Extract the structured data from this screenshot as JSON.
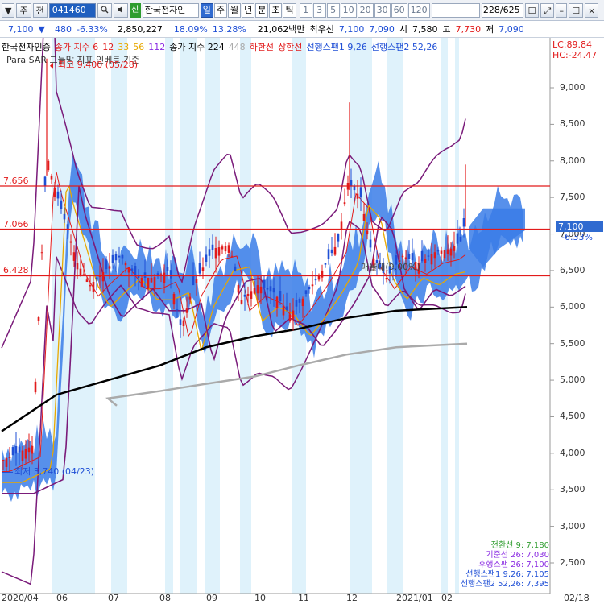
{
  "toolbar": {
    "btn_menu": "▼",
    "btn_ju": "주",
    "btn_jeon": "전",
    "code": "041460",
    "search_icon": "magnifier",
    "sound_icon": "speaker",
    "badge": "신",
    "stock_name": "한국전자인",
    "periods": [
      {
        "label": "일",
        "active": true
      },
      {
        "label": "주",
        "active": false
      },
      {
        "label": "월",
        "active": false
      },
      {
        "label": "년",
        "active": false
      },
      {
        "label": "분",
        "active": false
      },
      {
        "label": "초",
        "active": false
      },
      {
        "label": "틱",
        "active": false
      }
    ],
    "num_periods": [
      "1",
      "3",
      "5",
      "10",
      "20",
      "30",
      "60",
      "120"
    ],
    "pager": "228/625",
    "right_icons": [
      "checkbox-icon",
      "fullscreen-icon",
      "minimize-icon",
      "maximize-icon",
      "close-icon"
    ]
  },
  "info": {
    "price": "7,100",
    "arrow": "▼",
    "change": "480",
    "change_pct": "-6.33%",
    "volume": "2,850,227",
    "rate1": "18.09%",
    "rate2": "13.28%",
    "amount": "21,062백만",
    "label_uc": "최우선",
    "bid": "7,100",
    "ask": "7,090",
    "open_label": "시",
    "open": "7,580",
    "high_label": "고",
    "high": "7,730",
    "low_label": "저",
    "low": "7,090"
  },
  "legend": {
    "line1_items": [
      {
        "text": "한국전자인증",
        "color": "#000000"
      },
      {
        "text": "종가 지수 6",
        "color": "#e21b1b"
      },
      {
        "text": "12",
        "color": "#e21b1b"
      },
      {
        "text": "33",
        "color": "#e8a800"
      },
      {
        "text": "56",
        "color": "#e8a800"
      },
      {
        "text": "112",
        "color": "#8a2be2"
      },
      {
        "text": "종가 지수 224",
        "color": "#000000"
      },
      {
        "text": "448",
        "color": "#aaaaaa"
      },
      {
        "text": "하한선",
        "color": "#e21b1b"
      },
      {
        "text": "상한선",
        "color": "#e21b1b"
      },
      {
        "text": "선행스팬1 9,26",
        "color": "#1f4fd6"
      },
      {
        "text": "선행스팬2 52,26",
        "color": "#1f4fd6"
      }
    ],
    "line2": "Para SAR  그물망 지표  인베트 기준",
    "lc": "LC:89.84",
    "hc": "HC:-24.47"
  },
  "annotations": {
    "max_label": "최고 9,400 (05/28)",
    "min_label": "최저 3,740 (04/23)",
    "mid_label": "매물대(9.00%)"
  },
  "hlines": [
    {
      "label": "7,656",
      "value": 7656,
      "color": "#e21b1b"
    },
    {
      "label": "7,066",
      "value": 7066,
      "color": "#e21b1b"
    },
    {
      "label": "6,428",
      "value": 6428,
      "color": "#e21b1b"
    }
  ],
  "yaxis": {
    "ticks": [
      "9,000",
      "8,500",
      "8,000",
      "7,500",
      "7,000",
      "6,500",
      "6,000",
      "5,500",
      "5,000",
      "4,500",
      "4,000",
      "3,500",
      "3,000",
      "2,500"
    ],
    "current_price_label": "7,100",
    "current_pct_label": "-6.33%"
  },
  "xaxis": {
    "ticks": [
      "2020/04",
      "06",
      "07",
      "08",
      "09",
      "10",
      "11",
      "12",
      "2021/01",
      "02",
      "02/18"
    ]
  },
  "bottom_legend": [
    {
      "text": "전환선 9: 7,180",
      "color": "#2e9c2e"
    },
    {
      "text": "기준선 26: 7,030",
      "color": "#8a2be2"
    },
    {
      "text": "후행스팬 26: 7,100",
      "color": "#8a2be2"
    },
    {
      "text": "선행스팬1 9,26: 7,105",
      "color": "#1f4fd6"
    },
    {
      "text": "선행스팬2 52,26: 7,395",
      "color": "#1f4fd6"
    }
  ],
  "colors": {
    "up": "#e21b1b",
    "down": "#1f4fd6",
    "cloud": "#3a7de8",
    "band": "#7a1b7a",
    "ma_long": "#000000",
    "ma_gray": "#bbbbbb",
    "ma_orange": "#e8a800",
    "shade": "#dff2fb"
  },
  "chart_data": {
    "type": "line",
    "title": "한국전자인증",
    "y_range": [
      2500,
      9000
    ],
    "series": [
      {
        "name": "종가 지수 224",
        "color": "#000000",
        "x": [
          "2020/04",
          "06",
          "07",
          "08",
          "09",
          "10",
          "11",
          "12",
          "2021/01",
          "02"
        ],
        "values": [
          4300,
          4800,
          5000,
          5200,
          5450,
          5600,
          5700,
          5850,
          5950,
          6000
        ]
      },
      {
        "name": "448",
        "color": "#aaaaaa",
        "x": [
          "06",
          "07",
          "08",
          "09",
          "10",
          "11",
          "12",
          "2021/01",
          "02"
        ],
        "values": [
          4650,
          4750,
          4850,
          4950,
          5050,
          5200,
          5350,
          5450,
          5500
        ]
      }
    ]
  }
}
